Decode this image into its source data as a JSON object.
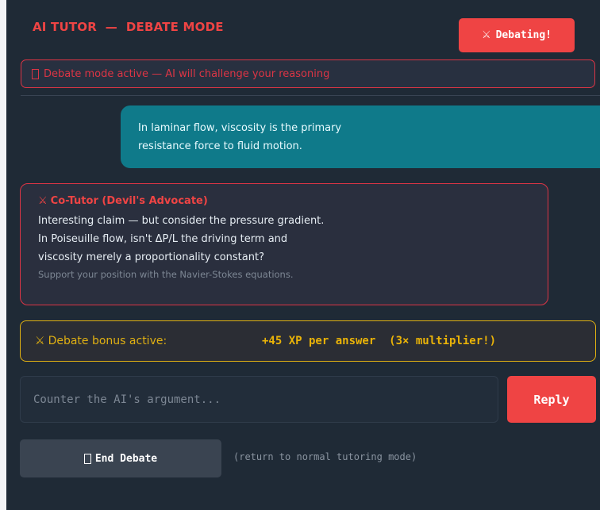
{
  "header": {
    "title": "AI TUTOR  —  DEBATE MODE",
    "status_button": {
      "icon": "crossed-swords-icon",
      "icon_glyph": "⚔",
      "label": "Debating!"
    }
  },
  "mode_banner": {
    "icon": "missing-glyph-box-icon",
    "text": "Debate mode active — AI will challenge your reasoning"
  },
  "user_message": {
    "lines": [
      "In laminar flow, viscosity is the primary",
      "resistance force to fluid motion."
    ]
  },
  "cotutor": {
    "icon": "crossed-swords-icon",
    "icon_glyph": "⚔",
    "name": "Co-Tutor (Devil's Advocate)",
    "lines": [
      "Interesting claim — but consider the pressure gradient.",
      "In Poiseuille flow, isn't ΔP/L the driving term and",
      "viscosity merely a proportionality constant?"
    ],
    "hint": "Support your position with the Navier-Stokes equations."
  },
  "bonus": {
    "icon": "crossed-swords-icon",
    "icon_glyph": "⚔",
    "label": "Debate bonus active:",
    "value": "+45 XP per answer  (3× multiplier!)"
  },
  "composer": {
    "value": "",
    "placeholder": "Counter the AI's argument...",
    "reply_label": "Reply"
  },
  "end_debate": {
    "icon": "missing-glyph-box-icon",
    "label": "End Debate",
    "hint": "(return to normal tutoring mode)"
  },
  "colors": {
    "background": "#1f2a36",
    "accent_red": "#ef4444",
    "user_bubble": "#0f7a8a",
    "bonus_gold": "#e0b012",
    "button_gray": "#3a4451"
  }
}
